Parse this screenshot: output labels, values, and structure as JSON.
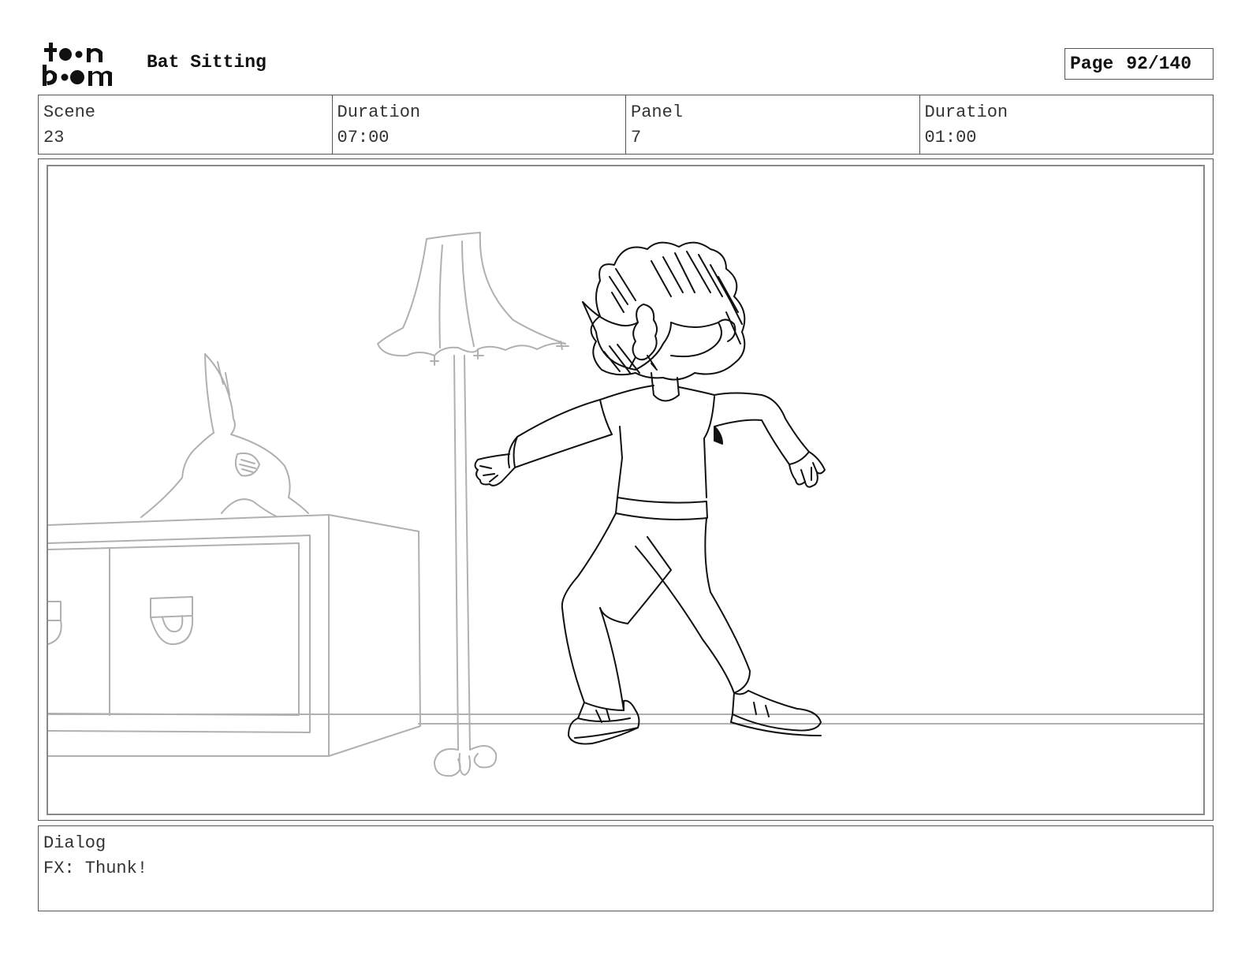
{
  "header": {
    "logo_text": "toon boom",
    "title": "Bat Sitting",
    "page_label": "Page",
    "page_value": "92/140"
  },
  "info": {
    "scene_label": "Scene",
    "scene_value": "23",
    "scene_duration_label": "Duration",
    "scene_duration_value": "07:00",
    "panel_label": "Panel",
    "panel_value": "7",
    "panel_duration_label": "Duration",
    "panel_duration_value": "01:00"
  },
  "dialog": {
    "label": "Dialog",
    "text": "FX: Thunk!"
  },
  "colors": {
    "sketch_line": "#111111",
    "background_line": "#b0b0b0",
    "frame": "#555555"
  }
}
